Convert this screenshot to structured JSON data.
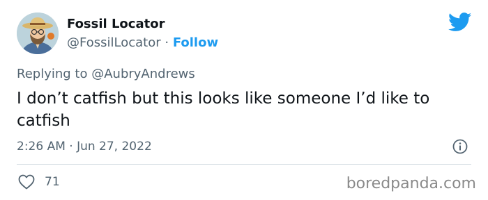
{
  "author": {
    "name": "Fossil Locator",
    "handle": "@FossilLocator",
    "separator": "·",
    "follow_label": "Follow"
  },
  "reply": {
    "prefix": "Replying to",
    "mention": "@AubryAndrews"
  },
  "tweet": {
    "text": "I don’t catfish but this looks like someone I’d like to catfish",
    "timestamp": "2:26 AM · Jun 27, 2022"
  },
  "stats": {
    "likes": "71"
  },
  "watermark": "boredpanda.com",
  "colors": {
    "brand": "#1d9bf0",
    "secondary_text": "#536471",
    "primary_text": "#0f1419"
  },
  "icons": {
    "brand": "twitter-bird-icon",
    "info": "info-icon",
    "like": "heart-icon"
  }
}
